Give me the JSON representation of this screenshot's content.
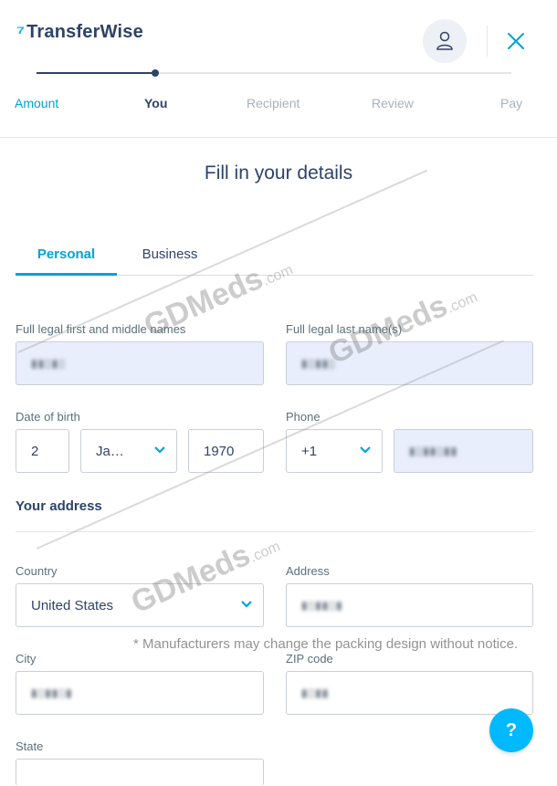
{
  "app": {
    "logo_text": "TransferWise",
    "logo_mark": "⁷"
  },
  "header": {
    "profile_icon": "user-icon",
    "close_icon": "close-icon"
  },
  "steps": {
    "items": [
      {
        "label": "Amount",
        "state": "done"
      },
      {
        "label": "You",
        "state": "current"
      },
      {
        "label": "Recipient",
        "state": "upcoming"
      },
      {
        "label": "Review",
        "state": "upcoming"
      },
      {
        "label": "Pay",
        "state": "upcoming"
      }
    ],
    "progress": 0.25
  },
  "page": {
    "title": "Fill in your details"
  },
  "tabs": {
    "personal": "Personal",
    "business": "Business",
    "selected": "Personal"
  },
  "form": {
    "first_name_label": "Full legal first and middle names",
    "first_name_value": "▮▮▯▮▯",
    "last_name_label": "Full legal last name(s)",
    "last_name_value": "▮▯▮▮▯",
    "dob_label": "Date of birth",
    "dob_day": "2",
    "dob_month": "Ja…",
    "dob_year": "1970",
    "phone_label": "Phone",
    "phone_code": "+1",
    "phone_number": "▮▯▮▮▯▮▮",
    "address_section_title": "Your address",
    "country_label": "Country",
    "country_value": "United States",
    "address_label": "Address",
    "address_value": "▮▯▮▮▯▮",
    "city_label": "City",
    "city_value": "▮▯▮▮▯▮",
    "zip_label": "ZIP code",
    "zip_value": "▮▯▮▮",
    "state_label": "State"
  },
  "help": {
    "label": "?"
  },
  "watermark": {
    "brand": "GDMeds",
    "suffix": ".com",
    "notice": "* Manufacturers may change the packing design without notice."
  },
  "colors": {
    "accent": "#00b9ff",
    "text": "#2e4369",
    "filled_bg": "#e8eefc"
  }
}
